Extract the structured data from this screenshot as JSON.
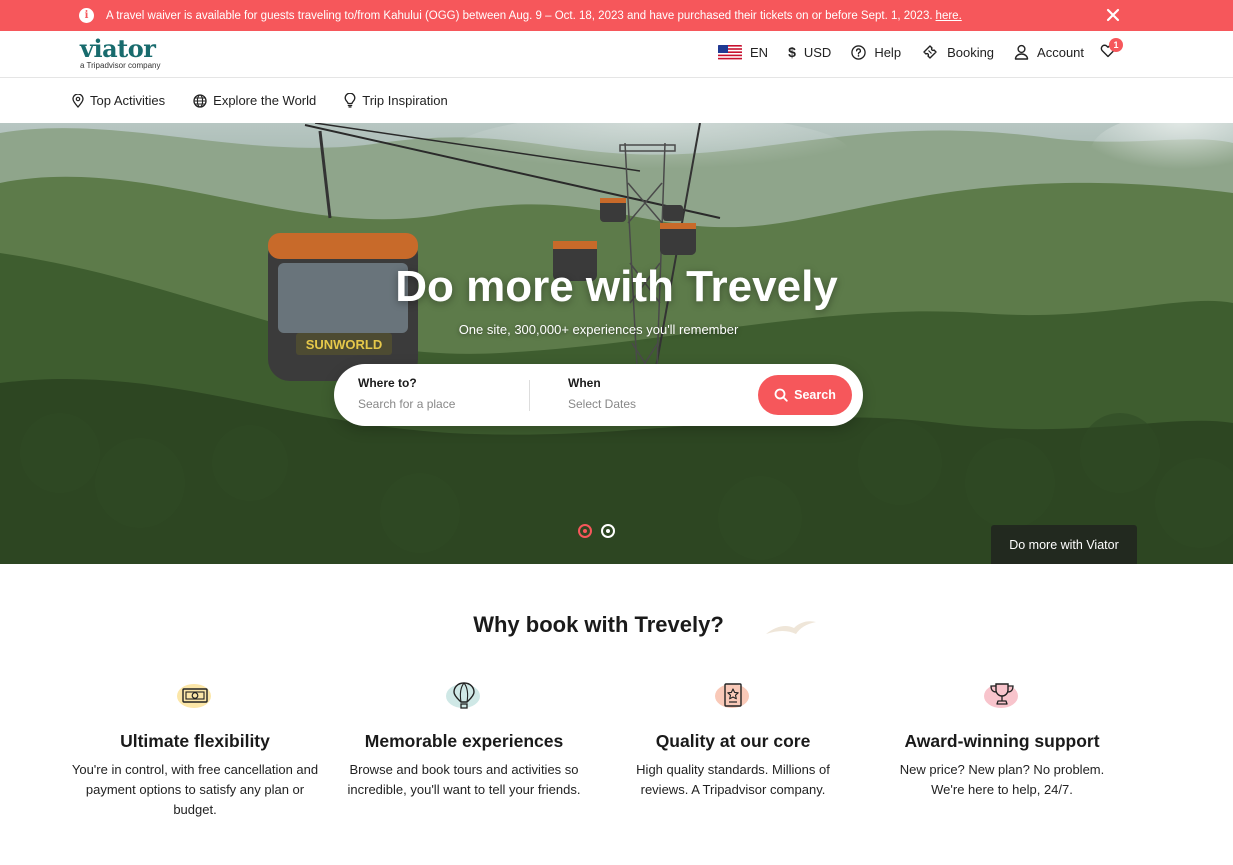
{
  "alert": {
    "message": "A travel waiver is available for guests traveling to/from Kahului (OGG) between Aug. 9 – Oct. 18, 2023 and have purchased their tickets on or before Sept. 1, 2023.",
    "link": "here."
  },
  "header": {
    "logo": "viator",
    "logo_sub": "a Tripadvisor company",
    "language": "EN",
    "currency_symbol": "$",
    "currency": "USD",
    "help": "Help",
    "booking": "Booking",
    "account": "Account",
    "wishlist_count": "1"
  },
  "subnav": {
    "items": [
      {
        "label": "Top Activities",
        "icon": "map-pin-icon"
      },
      {
        "label": "Explore the World",
        "icon": "globe-icon"
      },
      {
        "label": "Trip Inspiration",
        "icon": "lightbulb-icon"
      }
    ]
  },
  "hero": {
    "title": "Do more with Trevely",
    "subtitle": "One site, 300,000+ experiences you'll remember",
    "caption": "Do more with Viator"
  },
  "search": {
    "where_label": "Where to?",
    "where_placeholder": "Search for a place",
    "when_label": "When",
    "when_placeholder": "Select Dates",
    "button": "Search"
  },
  "why": {
    "title": "Why book with Trevely?",
    "features": [
      {
        "title": "Ultimate flexibility",
        "text": "You're in control, with free cancellation and payment options to satisfy any plan or budget.",
        "icon": "money-icon",
        "color": "#fbe6a8"
      },
      {
        "title": "Memorable experiences",
        "text": "Browse and book tours and activities so incredible, you'll want to tell your friends.",
        "icon": "balloon-icon",
        "color": "#cfe8e6"
      },
      {
        "title": "Quality at our core",
        "text": "High quality standards. Millions of reviews. A Tripadvisor company.",
        "icon": "award-icon",
        "color": "#f9c9b8"
      },
      {
        "title": "Award-winning support",
        "text": "New price? New plan? No problem. We're here to help, 24/7.",
        "icon": "trophy-icon",
        "color": "#f8c4cc"
      }
    ]
  },
  "colors": {
    "accent": "#f6575b",
    "brand": "#186b6d"
  }
}
